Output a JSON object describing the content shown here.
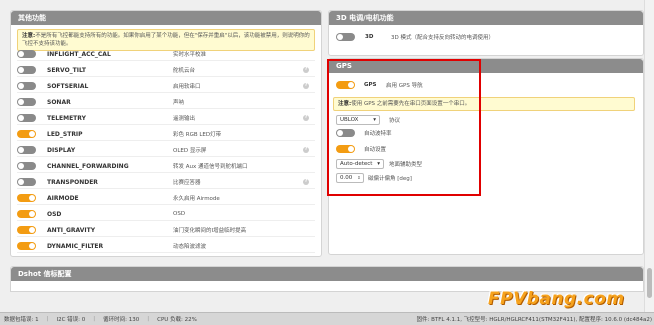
{
  "other_features": {
    "title": "其他功能",
    "note_bold": "注意:",
    "note_text": "不是所有飞控都能支持所有的功能。如果你启用了某个功能，但在\"保存并重启\"以后，该功能被禁用，则说明你的飞控不支持该功能。",
    "rows": [
      {
        "name": "INFLIGHT_ACC_CAL",
        "desc": "实时水平校准",
        "on": false,
        "help": false
      },
      {
        "name": "SERVO_TILT",
        "desc": "舵机云台",
        "on": false,
        "help": true
      },
      {
        "name": "SOFTSERIAL",
        "desc": "启用软串口",
        "on": false,
        "help": true
      },
      {
        "name": "SONAR",
        "desc": "声呐",
        "on": false,
        "help": false
      },
      {
        "name": "TELEMETRY",
        "desc": "遥测输出",
        "on": false,
        "help": true
      },
      {
        "name": "LED_STRIP",
        "desc": "彩色 RGB LED灯带",
        "on": true,
        "help": false
      },
      {
        "name": "DISPLAY",
        "desc": "OLED 显示屏",
        "on": false,
        "help": true
      },
      {
        "name": "CHANNEL_FORWARDING",
        "desc": "转发 Aux 通道信号到舵机端口",
        "on": false,
        "help": false
      },
      {
        "name": "TRANSPONDER",
        "desc": "比赛应答器",
        "on": false,
        "help": true
      },
      {
        "name": "AIRMODE",
        "desc": "永久启用 Airmode",
        "on": true,
        "help": false
      },
      {
        "name": "OSD",
        "desc": "OSD",
        "on": true,
        "help": false
      },
      {
        "name": "ANTI_GRAVITY",
        "desc": "油门变化瞬间的I增益临时提高",
        "on": true,
        "help": false
      },
      {
        "name": "DYNAMIC_FILTER",
        "desc": "动态陷波滤波",
        "on": true,
        "help": false
      }
    ]
  },
  "motor3d": {
    "title": "3D 电调/电机功能",
    "name": "3D",
    "desc": "3D 模式（配合支持反向转动的电调使用）"
  },
  "gps": {
    "title": "GPS",
    "name": "GPS",
    "desc": "启用 GPS 导航",
    "note_bold": "注意:",
    "note_text": "使用 GPS 之前需要先在串口页面设置一个串口。",
    "protocol_value": "UBLOX",
    "protocol_label": "协议",
    "auto_baud_label": "自动波特率",
    "auto_config_label": "自动设置",
    "sbas_value": "Auto-detect",
    "sbas_label": "地面辅助类型",
    "declination_value": "0.00",
    "declination_label": "磁偏计偏角 [deg]"
  },
  "dshot": {
    "title": "Dshot 信标配置"
  },
  "statusbar": {
    "packet_error": "数据包错误: 1",
    "i2c_error": "I2C 错误: 0",
    "cycle_time": "循环时间: 130",
    "cpu_load": "CPU 负载: 22%",
    "firmware": "固件: BTFL 4.1.1, 飞控型号: HGLR/HGLRCF411(STM32F411), 配置程序: 10.6.0 (dc484a2)"
  },
  "watermark": "FPVbang.com",
  "colors": {
    "accent": "#f39c12",
    "header": "#8c8c8c",
    "highlight_box": "#e00000"
  }
}
